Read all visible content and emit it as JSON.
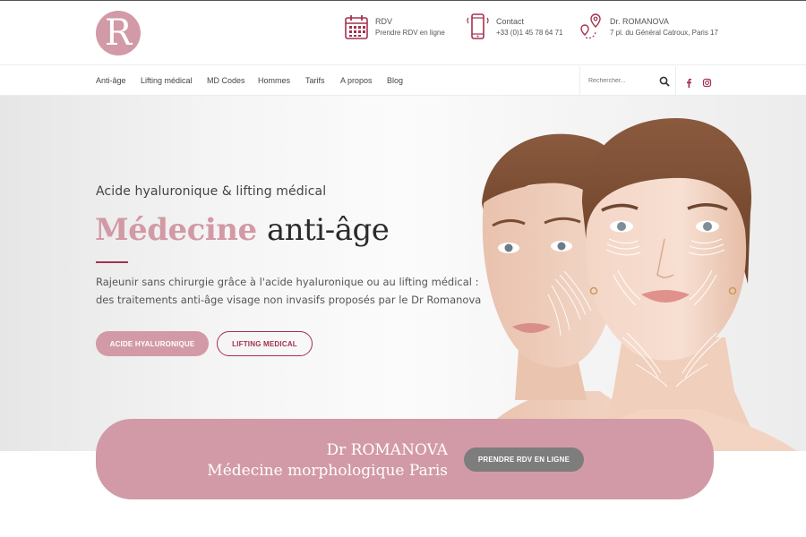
{
  "brand": {
    "accent": "#d29aa6",
    "accent_dark": "#a3324f",
    "logo_letter": "R"
  },
  "header": {
    "rdv": {
      "icon": "calendar-icon",
      "title": "RDV",
      "subtitle": "Prendre RDV en ligne"
    },
    "contact": {
      "icon": "phone-icon",
      "title": "Contact",
      "subtitle": "+33 (0)1 45 78 64 71"
    },
    "address": {
      "icon": "map-pin-icon",
      "title": "Dr. ROMANOVA",
      "subtitle": "7 pl. du Général Catroux, Paris 17"
    }
  },
  "nav": {
    "items": [
      {
        "label": "Anti-âge"
      },
      {
        "label": "Lifting médical"
      },
      {
        "label": "MD Codes"
      },
      {
        "label": "Hommes"
      },
      {
        "label": "Tarifs"
      },
      {
        "label": "A propos"
      },
      {
        "label": "Blog"
      }
    ],
    "search_placeholder": "Rechercher...",
    "social": [
      "facebook-icon",
      "instagram-icon"
    ]
  },
  "hero": {
    "kicker": "Acide hyaluronique & lifting médical",
    "title_accent": "Médecine",
    "title_rest": "anti-âge",
    "description": "Rajeunir sans chirurgie grâce à l'acide hyaluronique ou au lifting médical : des traitements anti-âge visage non invasifs proposés par le Dr Romanova",
    "btn_primary": "ACIDE HYALURONIQUE",
    "btn_secondary": "LIFTING MEDICAL"
  },
  "cta": {
    "name": "Dr ROMANOVA",
    "subtitle": "Médecine morphologique Paris",
    "button": "PRENDRE RDV EN LIGNE"
  }
}
